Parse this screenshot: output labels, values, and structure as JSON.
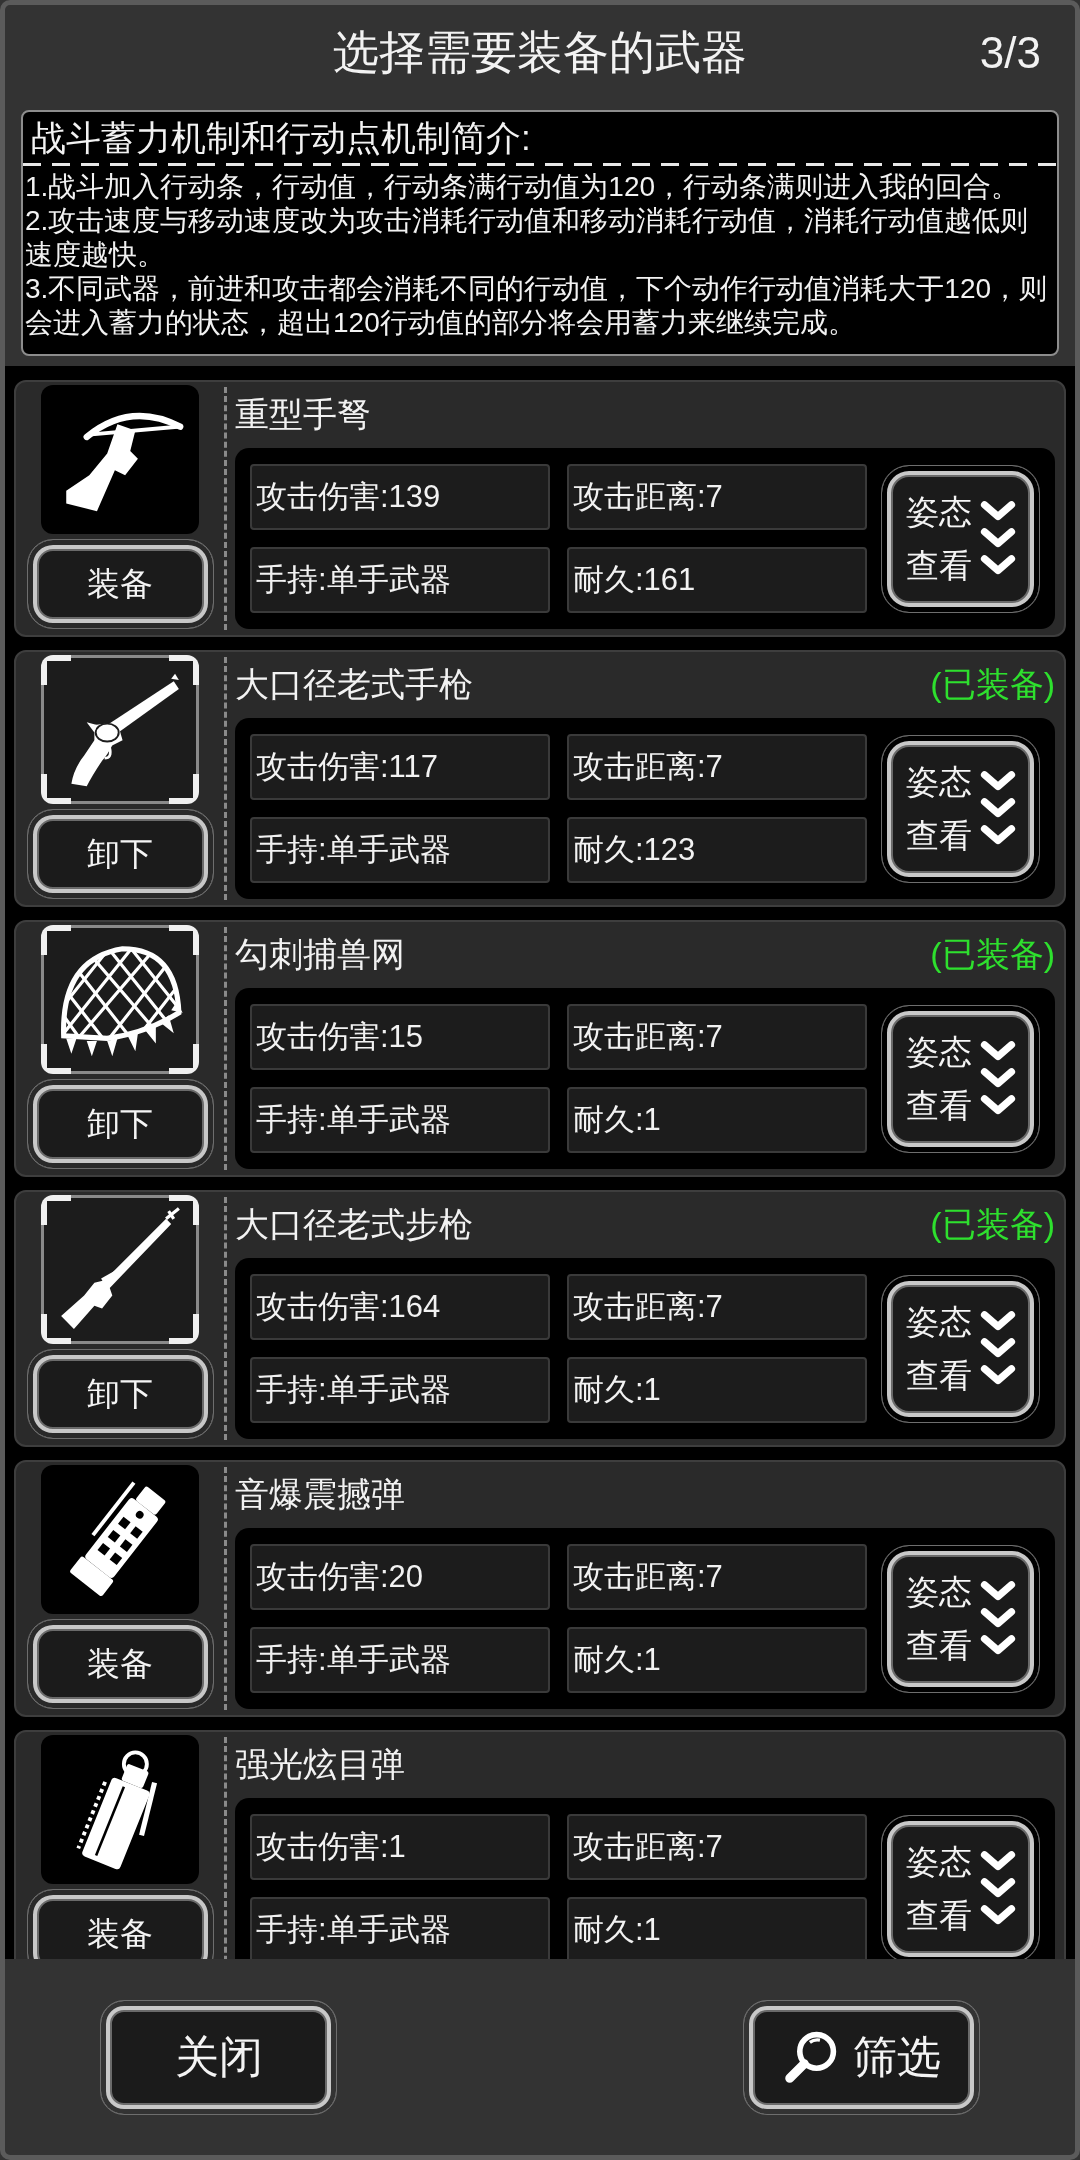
{
  "header": {
    "title": "选择需要装备的武器",
    "page": "3/3"
  },
  "intro": {
    "title": "战斗蓄力机制和行动点机制简介:",
    "paragraphs": [
      "1.战斗加入行动条，行动值，行动条满行动值为120，行动条满则进入我的回合。",
      "2.攻击速度与移动速度改为攻击消耗行动值和移动消耗行动值，消耗行动值越低则速度越快。",
      "3.不同武器，前进和攻击都会消耗不同的行动值，下个动作行动值消耗大于120，则会进入蓄力的状态，超出120行动值的部分将会用蓄力来继续完成。"
    ]
  },
  "weapons": [
    {
      "name": "重型手弩",
      "kind": "crossbow",
      "equipped": false,
      "button": "装备",
      "stats": [
        "攻击伤害:139",
        "攻击距离:7",
        "手持:单手武器",
        "耐久:161"
      ],
      "stance_button": [
        "姿态",
        "查看"
      ]
    },
    {
      "name": "大口径老式手枪",
      "kind": "revolver",
      "equipped": true,
      "status": "(已装备)",
      "button": "卸下",
      "stats": [
        "攻击伤害:117",
        "攻击距离:7",
        "手持:单手武器",
        "耐久:123"
      ],
      "stance_button": [
        "姿态",
        "查看"
      ]
    },
    {
      "name": "勾刺捕兽网",
      "kind": "net",
      "equipped": true,
      "status": "(已装备)",
      "button": "卸下",
      "stats": [
        "攻击伤害:15",
        "攻击距离:7",
        "手持:单手武器",
        "耐久:1"
      ],
      "stance_button": [
        "姿态",
        "查看"
      ]
    },
    {
      "name": "大口径老式步枪",
      "kind": "rifle",
      "equipped": true,
      "status": "(已装备)",
      "button": "卸下",
      "stats": [
        "攻击伤害:164",
        "攻击距离:7",
        "手持:单手武器",
        "耐久:1"
      ],
      "stance_button": [
        "姿态",
        "查看"
      ]
    },
    {
      "name": "音爆震撼弹",
      "kind": "stun_grenade",
      "equipped": false,
      "button": "装备",
      "stats": [
        "攻击伤害:20",
        "攻击距离:7",
        "手持:单手武器",
        "耐久:1"
      ],
      "stance_button": [
        "姿态",
        "查看"
      ]
    },
    {
      "name": "强光炫目弹",
      "kind": "flash_grenade",
      "equipped": false,
      "button": "装备",
      "stats": [
        "攻击伤害:1",
        "攻击距离:7",
        "手持:单手武器",
        "耐久:1"
      ],
      "stance_button": [
        "姿态",
        "查看"
      ]
    }
  ],
  "footer": {
    "close_button": "关闭",
    "filter_button": "筛选"
  }
}
